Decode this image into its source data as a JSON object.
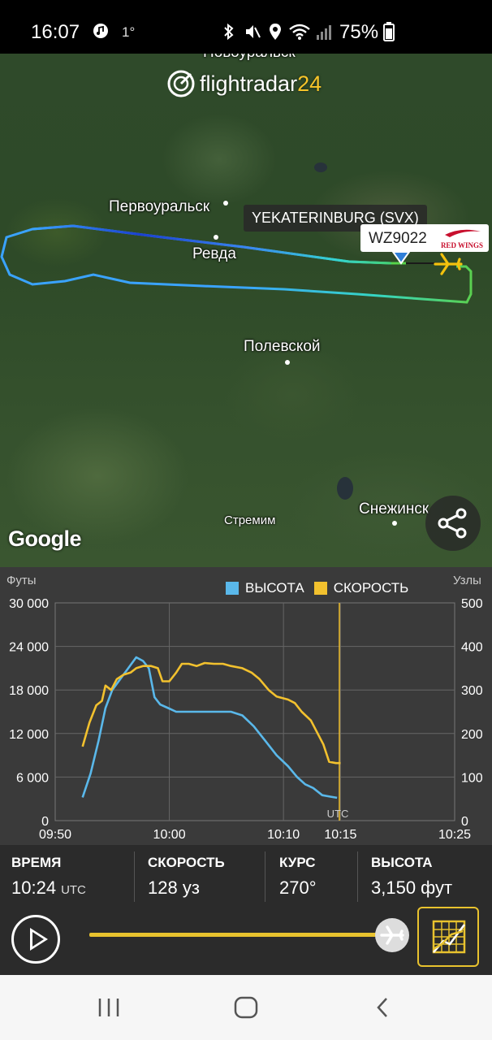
{
  "status_bar": {
    "time": "16:07",
    "temperature": "1°",
    "battery": "75%"
  },
  "map": {
    "brand": {
      "name": "flightradar",
      "number": "24"
    },
    "cities": [
      {
        "id": "novouralsk",
        "name": "Новоуральск"
      },
      {
        "id": "pervouralsk",
        "name": "Первоуральск"
      },
      {
        "id": "revda",
        "name": "Ревда"
      },
      {
        "id": "polevskoy",
        "name": "Полевской"
      },
      {
        "id": "snezhinsk",
        "name": "Снежинск"
      },
      {
        "id": "stremim",
        "name": "Стремим"
      }
    ],
    "airport_label": "YEKATERINBURG (SVX)",
    "flight_label": "WZ9022",
    "airline": "RED WINGS",
    "attribution": "Google",
    "share_icon": "share-icon"
  },
  "chart": {
    "left_axis_title": "Футы",
    "right_axis_title": "Узлы",
    "legend": [
      {
        "name": "ВЫСОТА",
        "color": "#5ab8ea"
      },
      {
        "name": "СКОРОСТЬ",
        "color": "#f2c12e"
      }
    ],
    "utc_marker": "UTC"
  },
  "chart_data": {
    "type": "line",
    "x_ticks": [
      "09:50",
      "10:00",
      "10:10",
      "10:15",
      "10:25"
    ],
    "y_left_ticks": [
      "0",
      "6 000",
      "12 000",
      "18 000",
      "24 000",
      "30 000"
    ],
    "y_right_ticks": [
      "0",
      "100",
      "200",
      "300",
      "400",
      "500"
    ],
    "y_left_range": [
      0,
      30000
    ],
    "y_right_range": [
      0,
      500
    ],
    "series": [
      {
        "name": "ВЫСОТА",
        "axis": "left",
        "color": "#5ab8ea",
        "points": [
          [
            0,
            3200
          ],
          [
            0.7,
            6500
          ],
          [
            1.4,
            11000
          ],
          [
            2,
            15500
          ],
          [
            2.6,
            18000
          ],
          [
            3.3,
            19500
          ],
          [
            4,
            21000
          ],
          [
            4.7,
            22500
          ],
          [
            5.3,
            22000
          ],
          [
            5.8,
            21000
          ],
          [
            6.3,
            17000
          ],
          [
            6.8,
            16000
          ],
          [
            7.5,
            15500
          ],
          [
            8.2,
            15000
          ],
          [
            9,
            15000
          ],
          [
            10,
            15000
          ],
          [
            11,
            15000
          ],
          [
            12,
            15000
          ],
          [
            13,
            15000
          ],
          [
            14,
            14500
          ],
          [
            15,
            13000
          ],
          [
            16,
            11000
          ],
          [
            17,
            9000
          ],
          [
            18,
            7500
          ],
          [
            18.8,
            6000
          ],
          [
            19.5,
            5000
          ],
          [
            20.2,
            4500
          ],
          [
            21,
            3500
          ],
          [
            21.7,
            3300
          ],
          [
            22.3,
            3150
          ]
        ]
      },
      {
        "name": "СКОРОСТЬ",
        "axis": "right",
        "color": "#f2c12e",
        "points": [
          [
            0,
            170
          ],
          [
            0.6,
            225
          ],
          [
            1.2,
            265
          ],
          [
            1.7,
            275
          ],
          [
            2,
            310
          ],
          [
            2.5,
            300
          ],
          [
            3,
            325
          ],
          [
            3.6,
            335
          ],
          [
            4.2,
            340
          ],
          [
            4.7,
            350
          ],
          [
            5.3,
            355
          ],
          [
            6,
            355
          ],
          [
            6.6,
            350
          ],
          [
            7,
            320
          ],
          [
            7.6,
            320
          ],
          [
            8.2,
            340
          ],
          [
            8.7,
            360
          ],
          [
            9.3,
            360
          ],
          [
            10,
            355
          ],
          [
            10.7,
            362
          ],
          [
            11.5,
            360
          ],
          [
            12.3,
            360
          ],
          [
            13,
            355
          ],
          [
            14,
            350
          ],
          [
            14.8,
            340
          ],
          [
            15.5,
            325
          ],
          [
            16.3,
            300
          ],
          [
            17,
            285
          ],
          [
            18,
            278
          ],
          [
            18.6,
            270
          ],
          [
            19.2,
            250
          ],
          [
            20,
            230
          ],
          [
            20.6,
            200
          ],
          [
            21.1,
            175
          ],
          [
            21.6,
            135
          ],
          [
            22.2,
            132
          ],
          [
            22.6,
            132
          ]
        ]
      }
    ]
  },
  "info": {
    "time": {
      "label": "ВРЕМЯ",
      "value": "10:24",
      "unit": "UTC"
    },
    "speed": {
      "label": "СКОРОСТЬ",
      "value": "128 уз"
    },
    "heading": {
      "label": "КУРС",
      "value": "270°"
    },
    "altitude": {
      "label": "ВЫСОТА",
      "value": "3,150 фут"
    }
  },
  "player": {
    "progress": 1.0
  }
}
